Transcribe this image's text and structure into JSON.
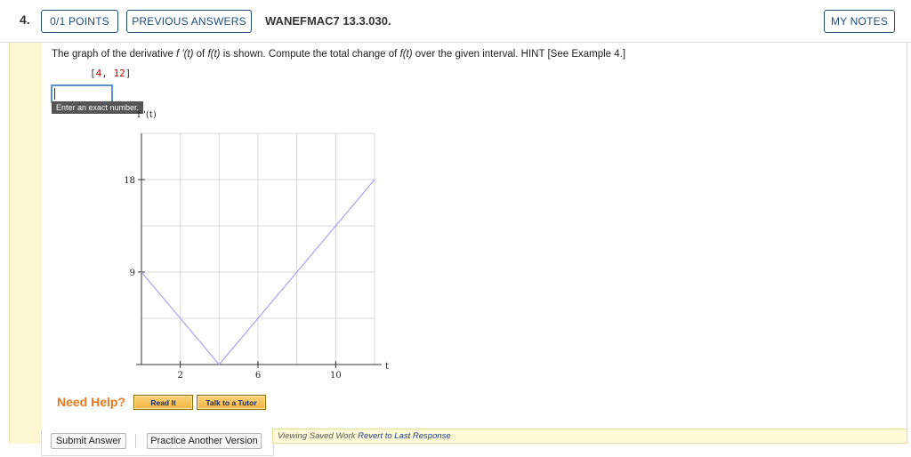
{
  "question": {
    "number": "4.",
    "points": "0/1 POINTS",
    "previous_answers": "PREVIOUS ANSWERS",
    "code": "WANEFMAC7 13.3.030.",
    "my_notes": "MY NOTES",
    "text_part1": "The graph of the derivative ",
    "text_fprime": "f '(t)",
    "text_part2": " of ",
    "text_f": "f(t)",
    "text_part3": " is shown. Compute the total change of ",
    "text_f2": "f(t)",
    "text_part4": " over the given interval. HINT [See Example 4.]",
    "interval_open": "[",
    "interval_a": "4",
    "interval_sep": ", ",
    "interval_b": "12",
    "interval_close": "]"
  },
  "answer": {
    "value": "",
    "tooltip": "Enter an exact number."
  },
  "chart_data": {
    "type": "line",
    "xlabel": "t",
    "ylabel": "f '(t)",
    "x_ticks": [
      2,
      6,
      10
    ],
    "y_ticks": [
      9,
      18
    ],
    "xlim": [
      0,
      12
    ],
    "ylim": [
      0,
      22.5
    ],
    "grid": true,
    "series": [
      {
        "x": [
          0,
          4,
          12
        ],
        "y": [
          9,
          0,
          18
        ],
        "color": "#a8a4f0"
      }
    ]
  },
  "help": {
    "label": "Need Help?",
    "read_it": "Read It",
    "talk_tutor": "Talk to a Tutor"
  },
  "actions": {
    "submit": "Submit Answer",
    "practice": "Practice Another Version"
  },
  "status": {
    "viewing": "Viewing Saved Work",
    "revert": "Revert to Last Response"
  }
}
